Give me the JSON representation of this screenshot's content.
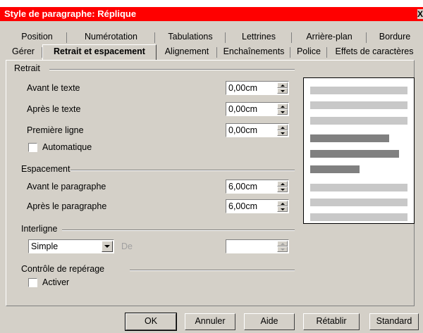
{
  "window": {
    "title": "Style de paragraphe: Réplique",
    "close_glyph": "X"
  },
  "tabs_back": [
    "Position",
    "Numérotation",
    "Tabulations",
    "Lettrines",
    "Arrière-plan",
    "Bordure"
  ],
  "tabs_front": [
    "Gérer",
    "Retrait et espacement",
    "Alignement",
    "Enchaînements",
    "Police",
    "Effets de caractères"
  ],
  "indent": {
    "group_label": "Retrait",
    "before_label": "Avant le texte",
    "before_value": "0,00cm",
    "after_label": "Après le texte",
    "after_value": "0,00cm",
    "first_label": "Première ligne",
    "first_value": "0,00cm",
    "auto_label": "Automatique"
  },
  "spacing": {
    "group_label": "Espacement",
    "above_label": "Avant le paragraphe",
    "above_value": "6,00cm",
    "below_label": "Après le paragraphe",
    "below_value": "6,00cm"
  },
  "linespacing": {
    "group_label": "Interligne",
    "selected": "Simple",
    "of_label": "De",
    "of_value": ""
  },
  "register": {
    "group_label": "Contrôle de repérage",
    "activate_label": "Activer"
  },
  "buttons": {
    "ok": "OK",
    "cancel": "Annuler",
    "help": "Aide",
    "reset": "Rétablir",
    "standard": "Standard"
  },
  "colors": {
    "titlebar": "#ff0000",
    "dialog": "#d4d0c8",
    "preview_light": "#c0c0c0",
    "preview_dark": "#808080"
  }
}
